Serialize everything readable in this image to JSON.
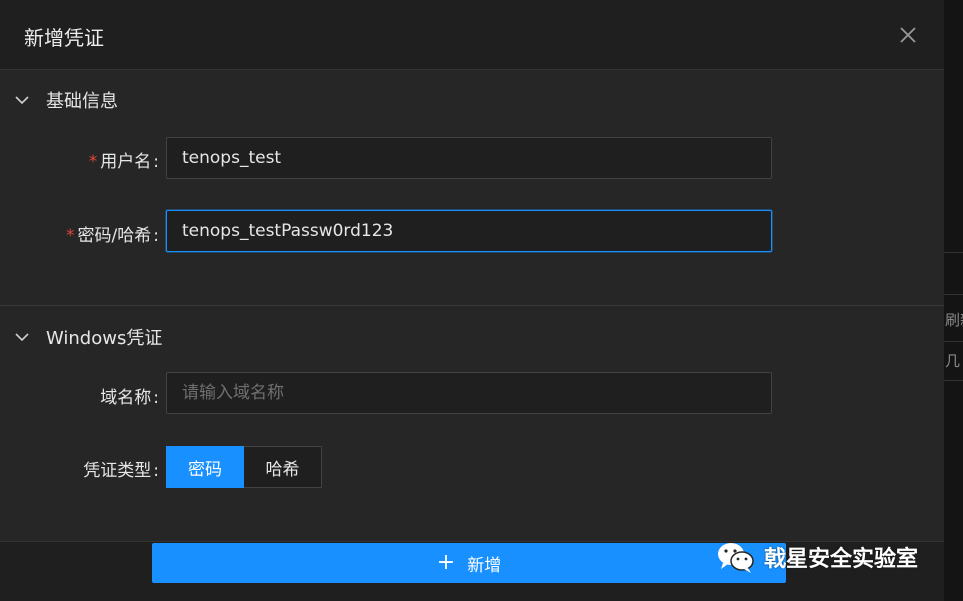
{
  "drawer": {
    "title": "新增凭证",
    "close_icon": "close-icon"
  },
  "sections": {
    "basic": {
      "title": "基础信息",
      "username_label": "用户名",
      "username_value": "tenops_test",
      "password_label": "密码/哈希",
      "password_value": "tenops_testPassw0rd123"
    },
    "windows": {
      "title": "Windows凭证",
      "domain_label": "域名称",
      "domain_placeholder": "请输入域名称",
      "cred_type_label": "凭证类型",
      "cred_type_options": [
        "密码",
        "哈希"
      ],
      "cred_type_selected": "密码"
    }
  },
  "footer": {
    "add_label": "新增"
  },
  "watermark": {
    "text": "戟星安全实验室"
  },
  "background_fragments": [
    "刷新",
    "几"
  ],
  "colors": {
    "accent": "#1890ff",
    "required": "#e0463a",
    "drawer_bg": "#262626"
  }
}
